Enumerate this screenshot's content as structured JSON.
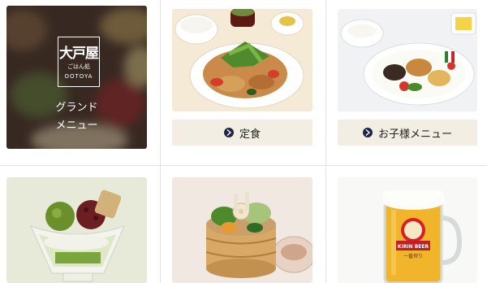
{
  "grand_menu": {
    "logo_kanji": "大戸屋",
    "logo_sub": "ごはん処",
    "logo_en": "OOTOYA",
    "title_line1": "グランド",
    "title_line2": "メニュー"
  },
  "cards": [
    {
      "label": "定食",
      "icon": "chevron-right-icon"
    },
    {
      "label": "お子様メニュー",
      "icon": "chevron-right-icon"
    }
  ],
  "bottom_images": [
    "parfait-dessert",
    "steamed-vegetable-seiro",
    "kirin-beer-mug"
  ],
  "beer_mug_text": {
    "brand": "KIRIN BEER",
    "sub": "一番搾り"
  },
  "colors": {
    "chevron_bg": "#1e2547",
    "label_bg": "#f3eee3",
    "divider": "#e8e4dc"
  }
}
